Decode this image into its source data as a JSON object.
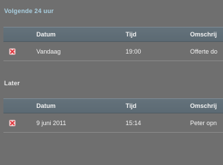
{
  "sections": {
    "upcoming": {
      "title": "Volgende 24 uur",
      "headers": {
        "datum": "Datum",
        "tijd": "Tijd",
        "omschrijving": "Omschrij"
      },
      "rows": [
        {
          "datum": "Vandaag",
          "tijd": "19:00",
          "omschrijving": "Offerte do"
        }
      ]
    },
    "later": {
      "title": "Later",
      "headers": {
        "datum": "Datum",
        "tijd": "Tijd",
        "omschrijving": "Omschrij"
      },
      "rows": [
        {
          "datum": "9 juni 2011",
          "tijd": "15:14",
          "omschrijving": "Peter opn"
        }
      ]
    }
  },
  "icons": {
    "row_action": "delete-icon"
  },
  "colors": {
    "background": "#6f6f6f",
    "header_bar": "#5f6d76",
    "section_title_upcoming": "#a9cfe0",
    "section_title_later": "#e9e9e9",
    "delete_icon": "#e0323a"
  }
}
